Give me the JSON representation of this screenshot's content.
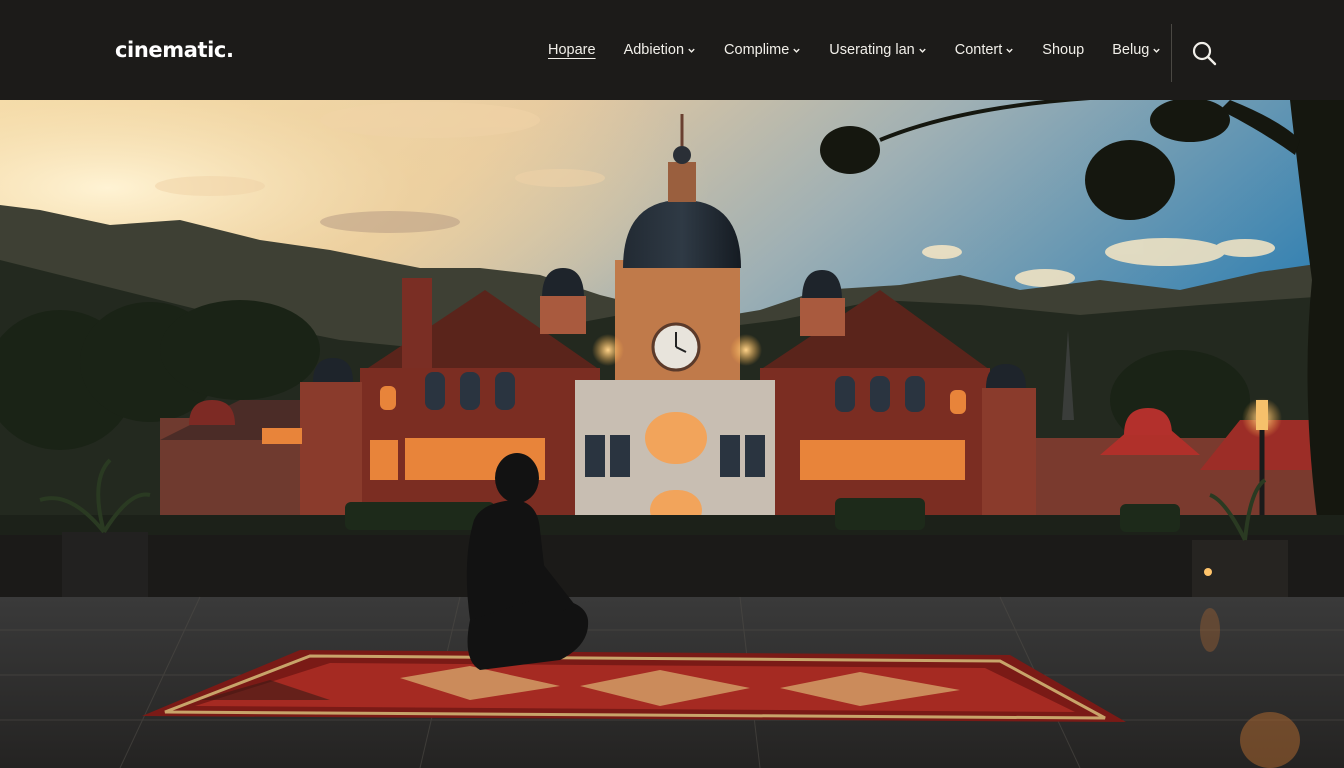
{
  "header": {
    "logo": "cinematic.",
    "nav": [
      {
        "label": "Hopare",
        "has_dropdown": false,
        "underlined": true
      },
      {
        "label": "Adbietion",
        "has_dropdown": true
      },
      {
        "label": "Complime",
        "has_dropdown": true
      },
      {
        "label": "Userating lan",
        "has_dropdown": true
      },
      {
        "label": "Contert",
        "has_dropdown": true
      },
      {
        "label": "Shoup",
        "has_dropdown": false
      },
      {
        "label": "Belug",
        "has_dropdown": true
      }
    ],
    "search_icon": "search-icon"
  },
  "hero": {
    "scene": "sunset-palace-with-seated-person-on-rug"
  },
  "colors": {
    "header_bg": "#1c1b19",
    "nav_text": "#f1efe9",
    "sky_glow": "#f3d7a0",
    "building": "#6e2a1e",
    "window_glow": "#e8843a",
    "rug": "#8c1b16"
  }
}
